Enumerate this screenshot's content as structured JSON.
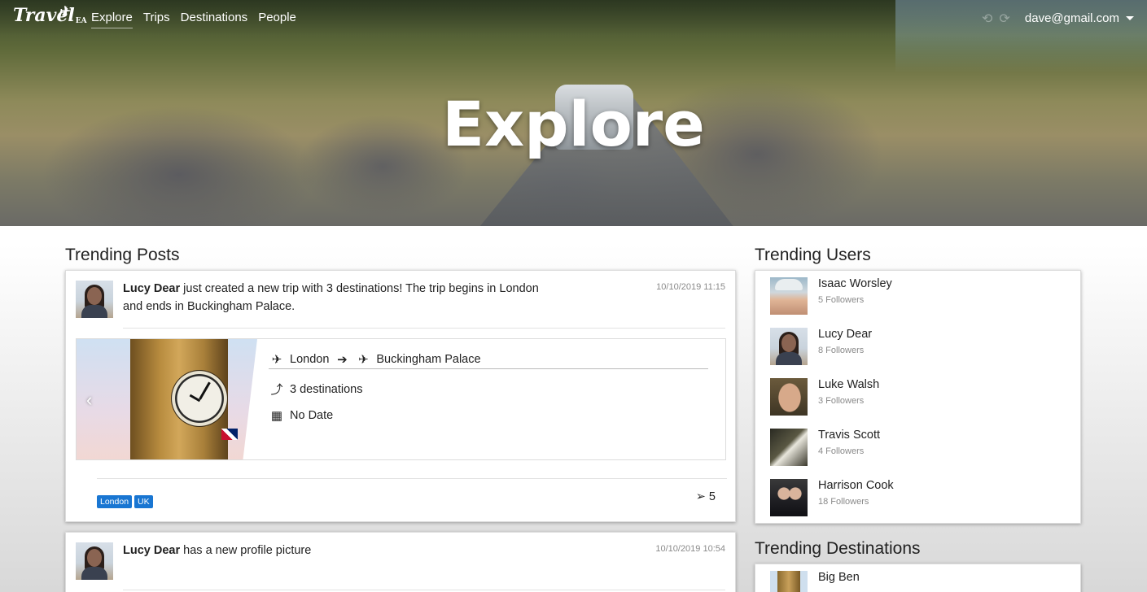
{
  "nav": {
    "brand": "Travel",
    "brand_suffix": "EA",
    "links": [
      "Explore",
      "Trips",
      "Destinations",
      "People"
    ],
    "active": "Explore",
    "user_email": "dave@gmail.com"
  },
  "hero": {
    "title": "Explore"
  },
  "trending_posts": {
    "heading": "Trending Posts",
    "posts": [
      {
        "author": "Lucy Dear",
        "text": "just created a new trip with 3 destinations! The trip begins in London",
        "text_line2": "and ends in Buckingham Palace.",
        "timestamp": "10/10/2019 11:15",
        "trip": {
          "from": "London",
          "to": "Buckingham Palace",
          "destinations": "3 destinations",
          "date": "No Date"
        },
        "tags": [
          "London",
          "UK"
        ],
        "likes": "5"
      },
      {
        "author": "Lucy Dear",
        "text": "has a new profile picture",
        "timestamp": "10/10/2019 10:54"
      }
    ]
  },
  "trending_users": {
    "heading": "Trending Users",
    "users": [
      {
        "name": "Isaac Worsley",
        "followers": "5 Followers"
      },
      {
        "name": "Lucy Dear",
        "followers": "8 Followers"
      },
      {
        "name": "Luke Walsh",
        "followers": "3 Followers"
      },
      {
        "name": "Travis Scott",
        "followers": "4 Followers"
      },
      {
        "name": "Harrison Cook",
        "followers": "18 Followers"
      }
    ]
  },
  "trending_destinations": {
    "heading": "Trending Destinations",
    "items": [
      {
        "name": "Big Ben"
      }
    ]
  },
  "colors": {
    "tag": "#1976d2",
    "timestamp": "#8a8a8a"
  }
}
